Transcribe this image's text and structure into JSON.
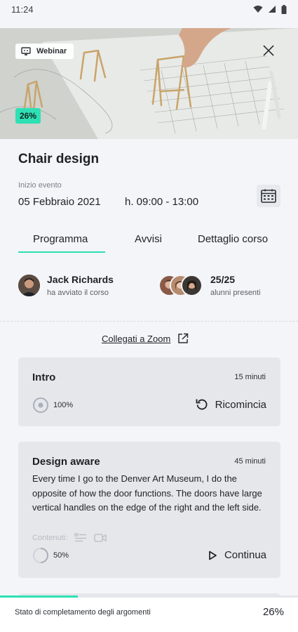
{
  "status_bar": {
    "time": "11:24"
  },
  "hero": {
    "badge_label": "Webinar",
    "progress_badge": "26%"
  },
  "course": {
    "title": "Chair design",
    "event_label": "Inizio evento",
    "event_date": "05 Febbraio 2021",
    "event_time": "h. 09:00 - 13:00"
  },
  "tabs": [
    {
      "label": "Programma",
      "active": true
    },
    {
      "label": "Avvisi",
      "active": false
    },
    {
      "label": "Dettaglio corso",
      "active": false
    }
  ],
  "teacher": {
    "name": "Jack Richards",
    "subtitle": "ha avviato il corso"
  },
  "students": {
    "count": "25/25",
    "subtitle": "alunni presenti"
  },
  "zoom_link": {
    "label": "Collegati a Zoom"
  },
  "lessons": [
    {
      "title": "Intro",
      "duration": "15 minuti",
      "progress_text": "100%",
      "progress": 1.0,
      "action_label": "Ricomincia",
      "action_icon": "restart-icon"
    },
    {
      "title": "Design aware",
      "duration": "45 minuti",
      "description": "Every time I go to the Denver Art Museum, I do the opposite of how the door functions. The doors have large vertical handles on the edge of the right and the left side.",
      "contents_label": "Contenuti:",
      "progress_text": "50%",
      "progress": 0.5,
      "action_label": "Continua",
      "action_icon": "play-icon"
    }
  ],
  "bottom_bar": {
    "label": "Stato di completamento degli argomenti",
    "percent_text": "26%",
    "progress": 0.26
  },
  "colors": {
    "accent": "#2ee0b4",
    "background": "#f3f5f9",
    "card": "#e5e7eb",
    "text": "#1e2126"
  }
}
